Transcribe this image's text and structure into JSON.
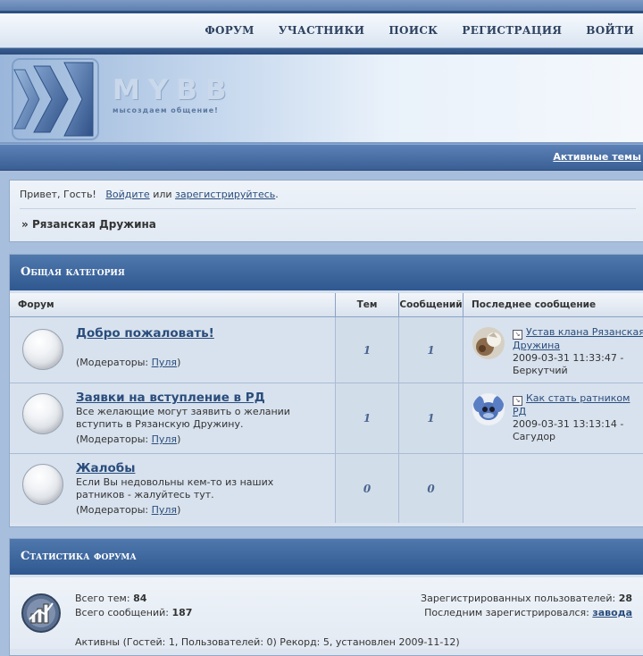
{
  "nav": {
    "items": [
      "ФОРУМ",
      "УЧАСТНИКИ",
      "ПОИСК",
      "РЕГИСТРАЦИЯ",
      "ВОЙТИ"
    ]
  },
  "header": {
    "logo_word": "MYBB",
    "logo_slogan": "мысоздаем общение!"
  },
  "active_topics": "Активные темы",
  "welcome": {
    "greeting": "Привет, Гость!",
    "login": "Войдите",
    "or": "или",
    "register": "зарегистрируйтесь",
    "period": ".",
    "crumb_prefix": "»",
    "crumb": "Рязанская Дружина"
  },
  "category": {
    "title": "Общая категория",
    "columns": {
      "forum": "Форум",
      "topics": "Тем",
      "posts": "Сообщений",
      "last": "Последнее сообщение"
    },
    "forums": [
      {
        "name": "Добро пожаловать!",
        "description": "",
        "moderators_label": "(Модераторы:",
        "moderator": "Пуля",
        "moderators_end": ")",
        "topics": "1",
        "posts": "1",
        "last_title": "Устав клана Рязанская Дружина",
        "last_date": "2009-03-31 11:33:47 -",
        "last_author": "Беркутчий"
      },
      {
        "name": "Заявки на вступление в РД",
        "description": "Все желающие могут заявить о желании вступить в Рязанскую Дружину.",
        "moderators_label": "(Модераторы:",
        "moderator": "Пуля",
        "moderators_end": ")",
        "topics": "1",
        "posts": "1",
        "last_title": "Как стать ратником РД",
        "last_date": "2009-03-31 13:13:14 -",
        "last_author": "Сагудор"
      },
      {
        "name": "Жалобы",
        "description": "Если Вы недовольны кем-то из наших ратников - жалуйтесь тут.",
        "moderators_label": "(Модераторы:",
        "moderator": "Пуля",
        "moderators_end": ")",
        "topics": "0",
        "posts": "0"
      }
    ]
  },
  "stats": {
    "title": "Статистика форума",
    "topics_label": "Всего тем:",
    "topics": "84",
    "posts_label": "Всего сообщений:",
    "posts": "187",
    "users_label": "Зарегистрированных пользователей:",
    "users": "28",
    "last_reg_label": "Последним зарегистрировался:",
    "last_reg": "завода",
    "active_line": "Активны (Гостей: 1, Пользователей: 0) Рекорд: 5, установлен 2009-11-12)"
  }
}
